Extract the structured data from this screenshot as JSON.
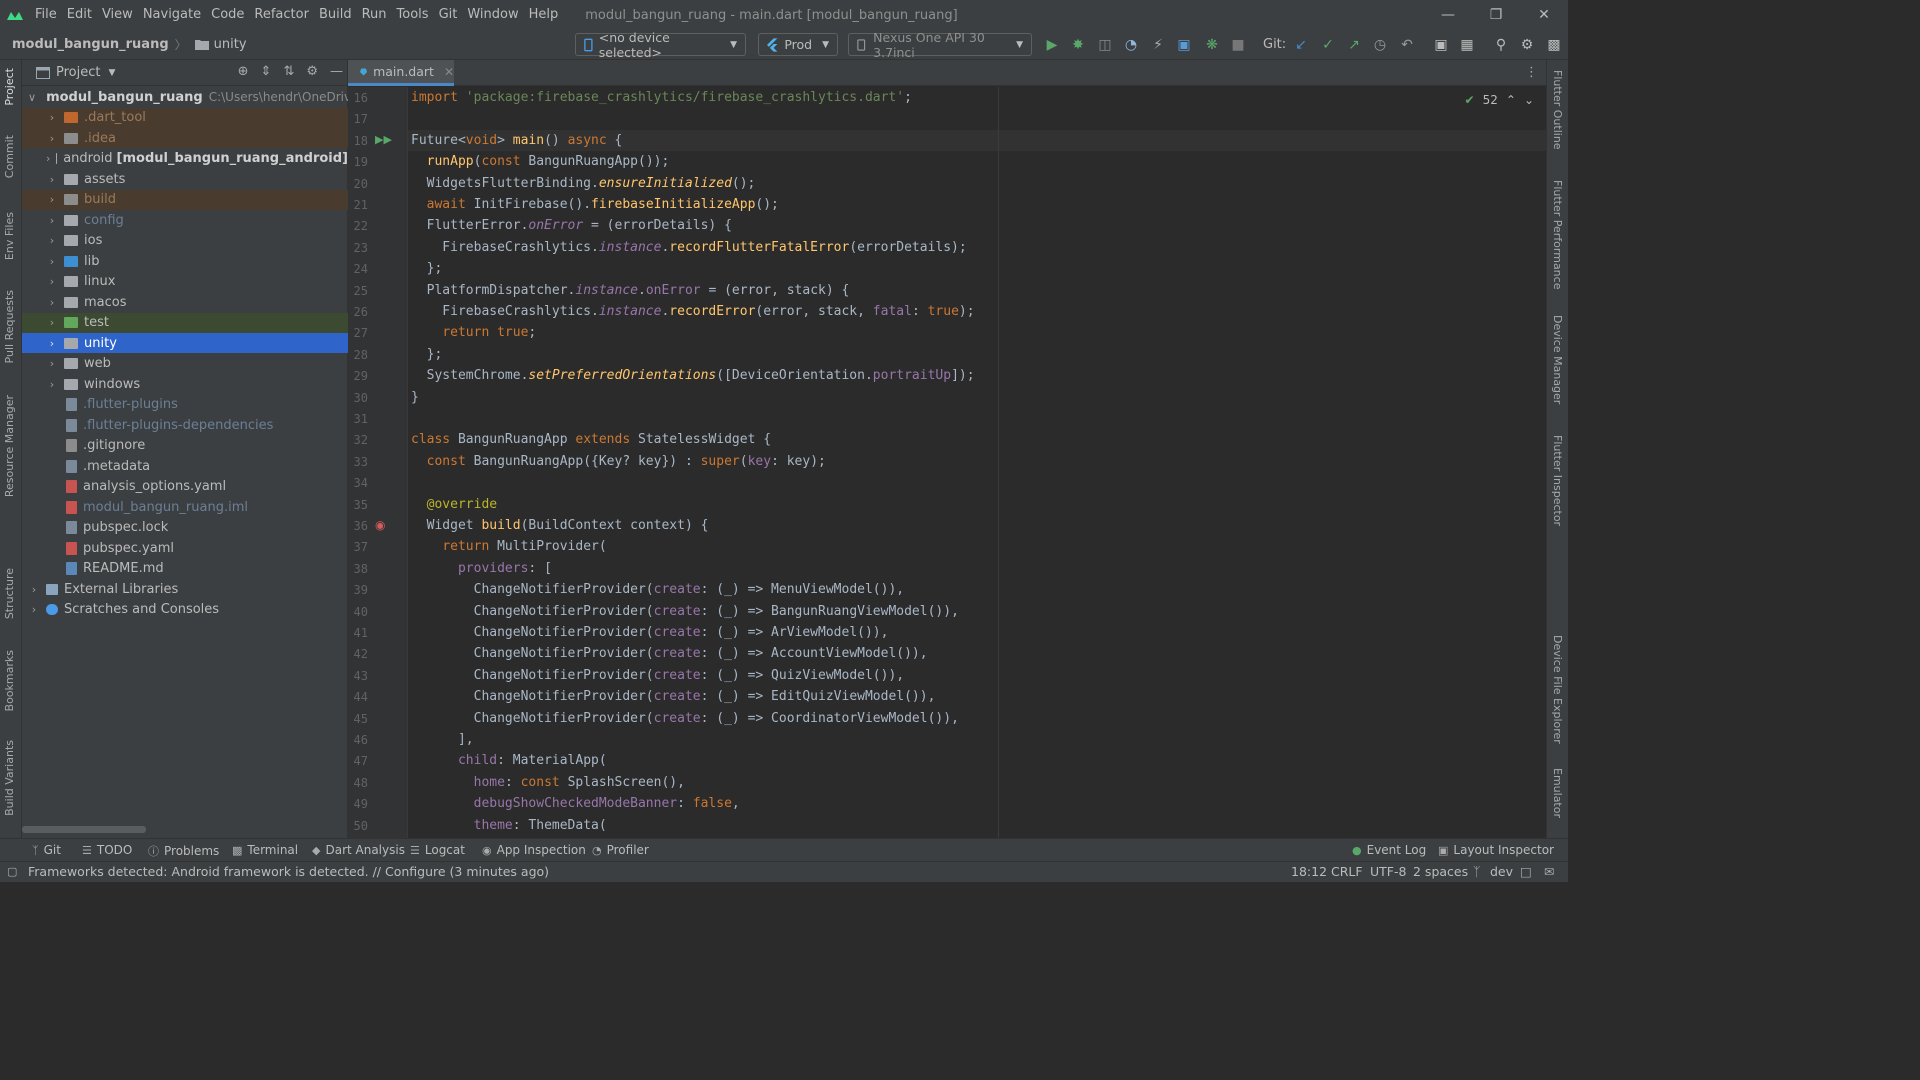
{
  "menubar": {
    "items": [
      "File",
      "Edit",
      "View",
      "Navigate",
      "Code",
      "Refactor",
      "Build",
      "Run",
      "Tools",
      "Git",
      "Window",
      "Help"
    ],
    "window_title": "modul_bangun_ruang - main.dart [modul_bangun_ruang]"
  },
  "navbar": {
    "project": "modul_bangun_ruang",
    "folder": "unity",
    "device_select": "<no device selected>",
    "flavor": "Prod",
    "emulator": "Nexus One API 30 3.7inci",
    "git_label": "Git:"
  },
  "project_panel": {
    "title": "Project",
    "rows": [
      {
        "label": "modul_bangun_ruang",
        "extra": "C:\\Users\\hendr\\OneDrive\\Dc"
      },
      {
        "label": ".dart_tool"
      },
      {
        "label": ".idea"
      },
      {
        "label": "android",
        "extra": "[modul_bangun_ruang_android]"
      },
      {
        "label": "assets"
      },
      {
        "label": "build"
      },
      {
        "label": "config"
      },
      {
        "label": "ios"
      },
      {
        "label": "lib"
      },
      {
        "label": "linux"
      },
      {
        "label": "macos"
      },
      {
        "label": "test"
      },
      {
        "label": "unity"
      },
      {
        "label": "web"
      },
      {
        "label": "windows"
      },
      {
        "label": ".flutter-plugins"
      },
      {
        "label": ".flutter-plugins-dependencies"
      },
      {
        "label": ".gitignore"
      },
      {
        "label": ".metadata"
      },
      {
        "label": "analysis_options.yaml"
      },
      {
        "label": "modul_bangun_ruang.iml"
      },
      {
        "label": "pubspec.lock"
      },
      {
        "label": "pubspec.yaml"
      },
      {
        "label": "README.md"
      },
      {
        "label": "External Libraries"
      },
      {
        "label": "Scratches and Consoles"
      }
    ]
  },
  "editor": {
    "tab": "main.dart",
    "inspection_count": "52",
    "line_numbers": [
      "16",
      "17",
      "18",
      "19",
      "20",
      "21",
      "22",
      "23",
      "24",
      "25",
      "26",
      "27",
      "28",
      "29",
      "30",
      "31",
      "32",
      "33",
      "34",
      "35",
      "36",
      "37",
      "38",
      "39",
      "40",
      "41",
      "42",
      "43",
      "44",
      "45",
      "46",
      "47",
      "48",
      "49",
      "50"
    ]
  },
  "left_tools": [
    "Project",
    "Commit",
    "Env Files",
    "Pull Requests",
    "Resource Manager",
    "Structure",
    "Bookmarks",
    "Build Variants"
  ],
  "right_tools": [
    "Flutter Outline",
    "Flutter Performance",
    "Device Manager",
    "Flutter Inspector",
    "Device File Explorer",
    "Emulator"
  ],
  "bottom_tools": [
    "Git",
    "TODO",
    "Problems",
    "Terminal",
    "Dart Analysis",
    "Logcat",
    "App Inspection",
    "Profiler",
    "Event Log",
    "Layout Inspector"
  ],
  "status": {
    "message": "Frameworks detected: Android framework is detected. // Configure (3 minutes ago)",
    "position": "18:12",
    "line_sep": "CRLF",
    "encoding": "UTF-8",
    "indent": "2 spaces",
    "branch": "dev"
  }
}
